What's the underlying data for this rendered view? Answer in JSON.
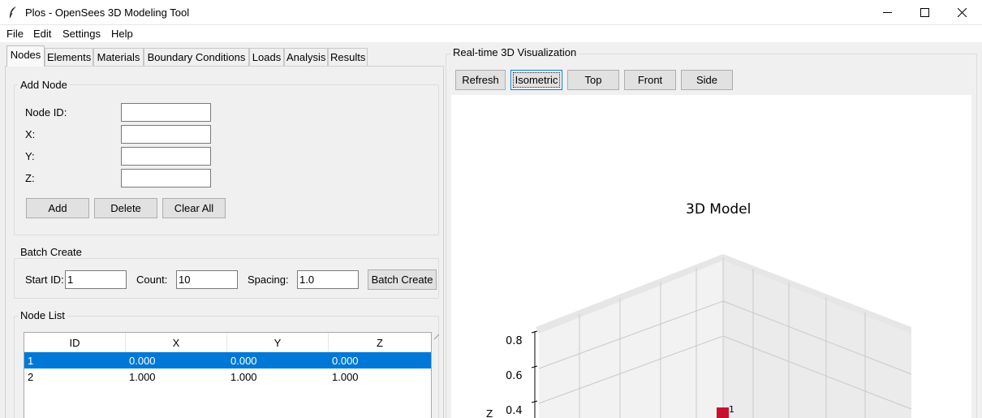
{
  "window": {
    "title": "Plos - OpenSees 3D Modeling Tool",
    "controls": [
      "minimize",
      "maximize",
      "close"
    ]
  },
  "menu": [
    "File",
    "Edit",
    "Settings",
    "Help"
  ],
  "tabs": [
    "Nodes",
    "Elements",
    "Materials",
    "Boundary Conditions",
    "Loads",
    "Analysis",
    "Results"
  ],
  "add_node": {
    "title": "Add Node",
    "fields": [
      {
        "label": "Node ID:",
        "value": ""
      },
      {
        "label": "X:",
        "value": ""
      },
      {
        "label": "Y:",
        "value": ""
      },
      {
        "label": "Z:",
        "value": ""
      }
    ],
    "buttons": [
      "Add",
      "Delete",
      "Clear All"
    ]
  },
  "batch": {
    "title": "Batch Create",
    "start_id_label": "Start ID:",
    "start_id_value": "1",
    "count_label": "Count:",
    "count_value": "10",
    "spacing_label": "Spacing:",
    "spacing_value": "1.0",
    "button": "Batch Create"
  },
  "node_list": {
    "title": "Node List",
    "columns": [
      "ID",
      "X",
      "Y",
      "Z"
    ],
    "rows": [
      {
        "id": "1",
        "x": "0.000",
        "y": "0.000",
        "z": "0.000",
        "selected": true
      },
      {
        "id": "2",
        "x": "1.000",
        "y": "1.000",
        "z": "1.000",
        "selected": false
      }
    ]
  },
  "viz": {
    "title": "Real-time 3D Visualization",
    "buttons": [
      "Refresh",
      "Isometric",
      "Top",
      "Front",
      "Side"
    ],
    "active_button": "Isometric",
    "plot_title": "3D Model",
    "z_ticks": [
      "0.8",
      "0.6",
      "0.4"
    ],
    "z_axis_label": "Z",
    "node_label": "1",
    "node_color": "#c8102e"
  },
  "colors": {
    "selection": "#0078d7",
    "window_bg": "#f0f0f0"
  }
}
